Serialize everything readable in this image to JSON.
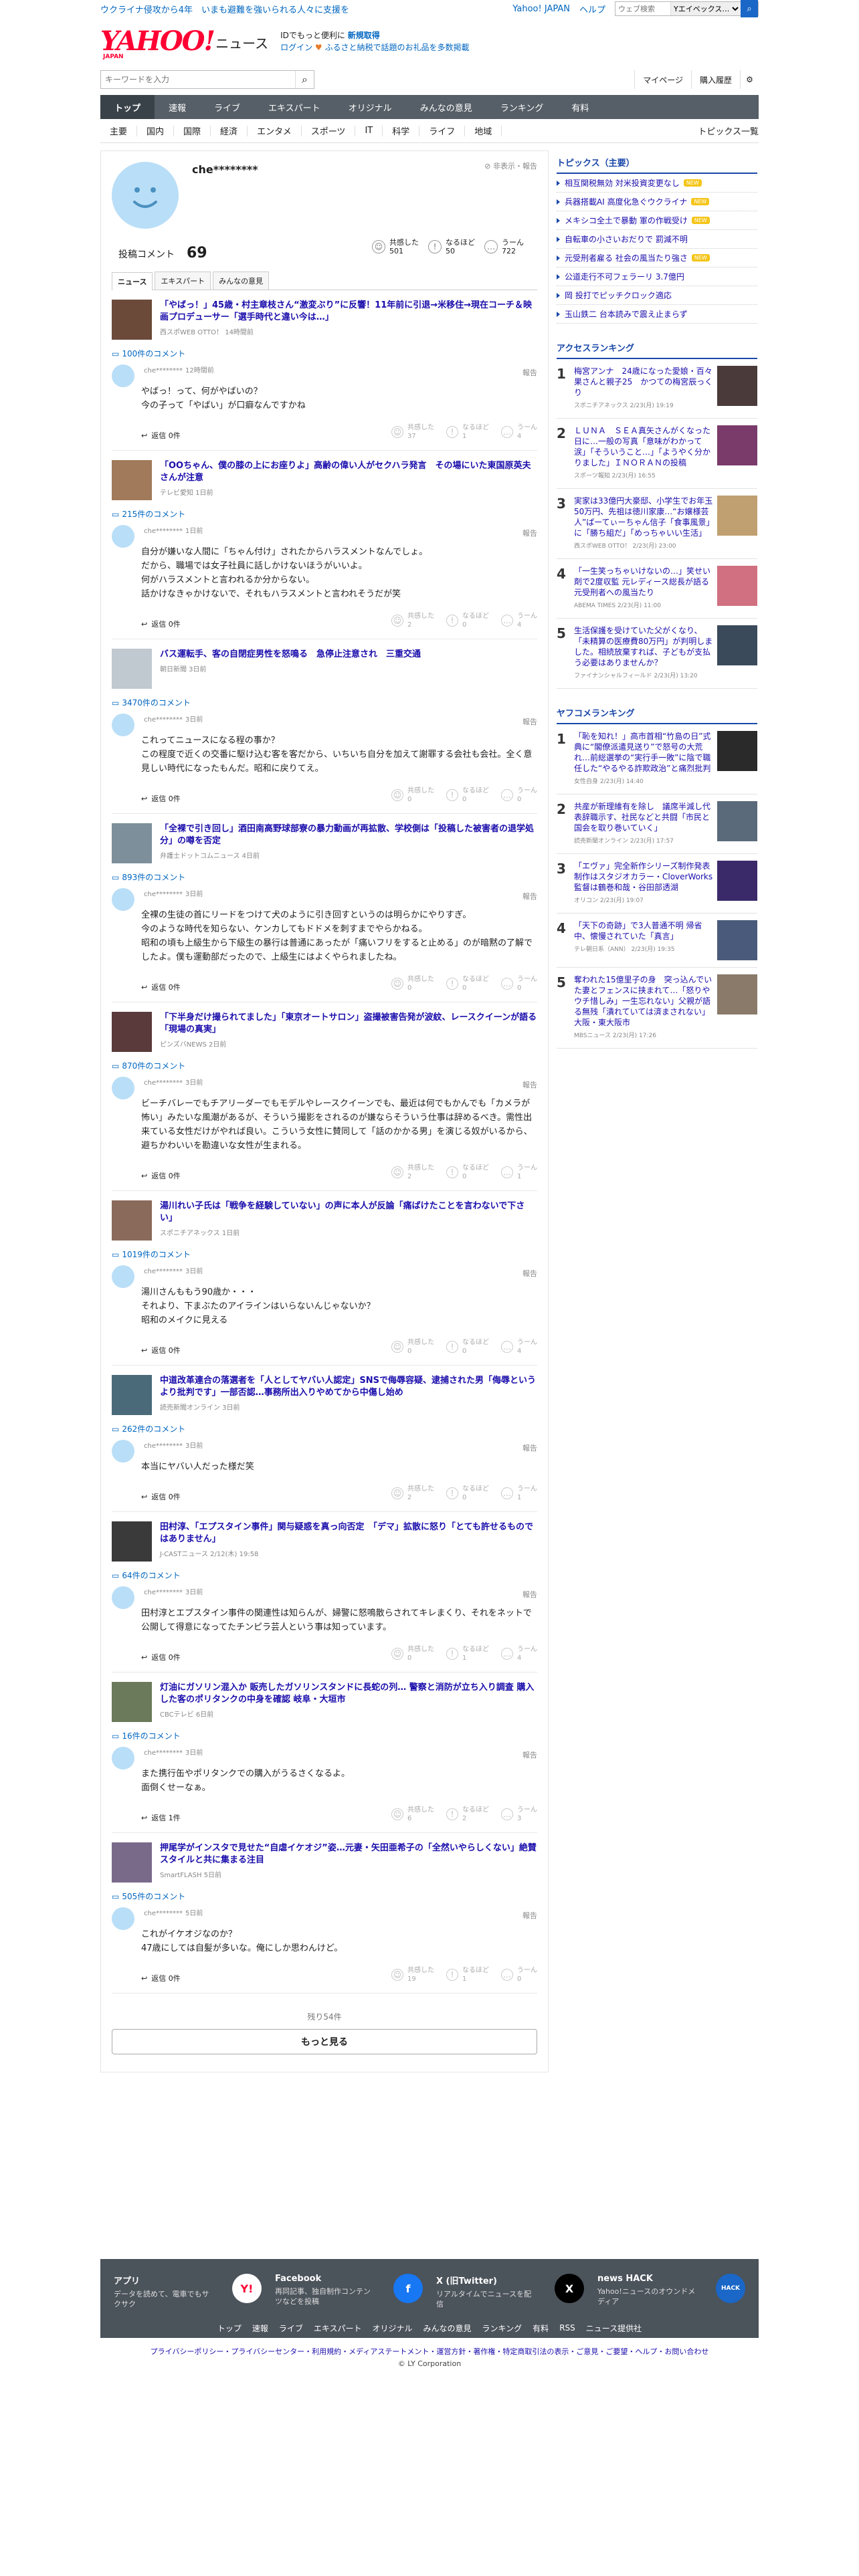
{
  "header": {
    "promo": "ウクライナ侵攻から4年　いまも避難を強いられる人々に支援を",
    "links": [
      "Yahoo! JAPAN",
      "ヘルプ"
    ],
    "mini_search_placeholder": "ウェブ検索",
    "mini_search_scope": "Yエイベックス…",
    "logo_text": "YAHOO!",
    "logo_sub": "JAPAN",
    "logo_news": "ニュース",
    "msg1": "IDでもっと便利に",
    "msg1b": "新規取得",
    "msg2": "ログイン",
    "msg2b": "ふるさと納税で話題のお礼品を多数掲載",
    "search_placeholder": "キーワードを入力",
    "mypage": "マイページ",
    "history": "購入履歴"
  },
  "nav": [
    "トップ",
    "速報",
    "ライブ",
    "エキスパート",
    "オリジナル",
    "みんなの意見",
    "ランキング",
    "有料"
  ],
  "subnav": [
    "主要",
    "国内",
    "国際",
    "経済",
    "エンタメ",
    "スポーツ",
    "IT",
    "科学",
    "ライフ",
    "地域"
  ],
  "subnav_right": "トピックス一覧",
  "profile": {
    "username": "che********",
    "report": "非表示・報告",
    "count_label": "投稿コメント",
    "count": "69",
    "stats": [
      {
        "icon": "☺",
        "label": "共感した",
        "value": "501"
      },
      {
        "icon": "!",
        "label": "なるほど",
        "value": "50"
      },
      {
        "icon": "…",
        "label": "うーん",
        "value": "722"
      }
    ],
    "tabs": [
      "ニュース",
      "エキスパート",
      "みんなの意見"
    ]
  },
  "items": [
    {
      "title": "「やばっ！」45歳・村主章枝さん“激変ぶり”に反響！11年前に引退→米移住→現在コーチ＆映画プロデューサー「選手時代と違い今は…」",
      "src": "西スポWEB OTTO！ 14時間前",
      "ccount": "100件のコメント",
      "user": "che********",
      "time": "12時間前",
      "text": "やばっ！って、何がやばいの？\n今の子って「やばい」が口癖なんですかね",
      "reply": "返信 0件",
      "r": [
        "37",
        "1",
        "4"
      ],
      "thumbColor": "#6b4a3a"
    },
    {
      "title": "「OOちゃん、僕の膝の上にお座りよ」高齢の偉い人がセクハラ発言　その場にいた東国原英夫さんが注意",
      "src": "テレビ愛知 1日前",
      "ccount": "215件のコメント",
      "user": "che********",
      "time": "1日前",
      "text": "自分が嫌いな人間に「ちゃん付け」されたからハラスメントなんでしょ。\nだから、職場では女子社員に話しかけないほうがいいよ。\n何がハラスメントと言われるか分からない。\n話かけなきゃかけないで、それもハラスメントと言われそうだが笑",
      "reply": "返信 0件",
      "r": [
        "2",
        "0",
        "4"
      ],
      "thumbColor": "#a07a5a"
    },
    {
      "title": "バス運転手、客の自閉症男性を怒鳴る　急停止注意され　三重交通",
      "src": "朝日新聞 3日前",
      "ccount": "3470件のコメント",
      "user": "che********",
      "time": "3日前",
      "text": "これってニュースになる程の事か？\nこの程度で近くの交番に駆け込む客を客だから、いちいち自分を加えて謝罪する会社も会社。全く意見しい時代になったもんだ。昭和に戻りてえ。",
      "reply": "返信 0件",
      "r": [
        "0",
        "0",
        "0"
      ],
      "thumbColor": "#c0c8d0"
    },
    {
      "title": "「全裸で引き回し」酒田南高野球部寮の暴力動画が再拡散、学校側は「投稿した被害者の退学処分」の噂を否定",
      "src": "弁護士ドットコムニュース 4日前",
      "ccount": "893件のコメント",
      "user": "che********",
      "time": "3日前",
      "text": "全裸の生徒の首にリードをつけて犬のように引き回すというのは明らかにやりすぎ。\n今のような時代を知らない、ケンカしてもドドメを刺すまでやらかねる。\n昭和の頃も上級生から下級生の暴行は普通にあったが「痛いフリをすると止める」のが暗黙の了解でしたよ。僕も運動部だったので、上級生にはよくやられましたね。",
      "reply": "返信 0件",
      "r": [
        "0",
        "0",
        "0"
      ],
      "thumbColor": "#7d8f9a"
    },
    {
      "title": "「下半身だけ撮られてました」「東京オートサロン」盗撮被害告発が波紋、レースクイーンが語る「現場の真実」",
      "src": "ピンズバNEWS 2日前",
      "ccount": "870件のコメント",
      "user": "che********",
      "time": "3日前",
      "text": "ビーチバレーでもチアリーダーでもモデルやレースクイーンでも、最近は何でもかんでも「カメラが怖い」みたいな風潮があるが、そういう撮影をされるのが嫌ならそういう仕事は辞めるべき。需性出来ている女性だけがやれば良い。こういう女性に賛同して「話のかかる男」を演じる奴がいるから、避ちかわいいを勘違いな女性が生まれる。",
      "reply": "返信 0件",
      "r": [
        "2",
        "0",
        "1"
      ],
      "thumbColor": "#5a3a3a"
    },
    {
      "title": "湯川れい子氏は「戦争を経験していない」の声に本人が反論「痛ばけたことを言わないで下さい」",
      "src": "スポニチアネックス 1日前",
      "ccount": "1019件のコメント",
      "user": "che********",
      "time": "3日前",
      "text": "湯川さんももう90歳か・・・\nそれより、下まぶたのアイラインはいらないんじゃないか？\n昭和のメイクに見える",
      "reply": "返信 0件",
      "r": [
        "0",
        "0",
        "4"
      ],
      "thumbColor": "#8a6a5a"
    },
    {
      "title": "中道改革連合の落選者を「人としてヤバい人認定」SNSで侮辱容疑、逮捕された男「侮辱というより批判です」一部否認…事務所出入りやめてから中傷し始め",
      "src": "読売新聞オンライン 3日前",
      "ccount": "262件のコメント",
      "user": "che********",
      "time": "3日前",
      "text": "本当にヤバい人だった様だ笑",
      "reply": "返信 0件",
      "r": [
        "2",
        "0",
        "1"
      ],
      "thumbColor": "#4a6a7a"
    },
    {
      "title": "田村淳、「エプスタイン事件」関与疑惑を真っ向否定　「デマ」拡散に怒り「とても許せるものではありません」",
      "src": "J-CASTニュース 2/12(木) 19:58",
      "ccount": "64件のコメント",
      "user": "che********",
      "time": "3日前",
      "text": "田村淳とエプスタイン事件の関連性は知らんが、婦警に怒鳴散らされてキレまくり、それをネットで公開して得意になってたチンピラ芸人という事は知っています。",
      "reply": "返信 0件",
      "r": [
        "0",
        "1",
        "4"
      ],
      "thumbColor": "#3a3a3a"
    },
    {
      "title": "灯油にガソリン混入か 販売したガソリンスタンドに長蛇の列… 警察と消防が立ち入り調査 購入した客のポリタンクの中身を確認 岐阜・大垣市",
      "src": "CBCテレビ 6日前",
      "ccount": "16件のコメント",
      "user": "che********",
      "time": "3日前",
      "text": "また携行缶やポリタンクでの購入がうるさくなるよ。\n面倒くせーなぁ。",
      "reply": "返信 1件",
      "r": [
        "6",
        "2",
        "3"
      ],
      "thumbColor": "#6a7a5a"
    },
    {
      "title": "押尾学がインスタで見せた“自虐イケオジ”姿…元妻・矢田亜希子の「全然いやらしくない」絶賛スタイルと共に集まる注目",
      "src": "SmartFLASH 5日前",
      "ccount": "505件のコメント",
      "user": "che********",
      "time": "5日前",
      "text": "これがイケオジなのか？\n47歳にしては自髪が多いな。俺にしか思わんけど。",
      "reply": "返信 0件",
      "r": [
        "19",
        "1",
        "0"
      ],
      "thumbColor": "#7a6a8a"
    }
  ],
  "more": {
    "remaining": "残り54件",
    "button": "もっと見る"
  },
  "sidebar": {
    "topics_title": "トピックス（主要）",
    "topics": [
      {
        "t": "相互関税無効 対米投資変更なし",
        "new": "NEW"
      },
      {
        "t": "兵器搭載AI 高度化急ぐウクライナ",
        "new": "NEW"
      },
      {
        "t": "メキシコ全土で暴動 軍の作戦受け",
        "new": "NEW"
      },
      {
        "t": "自転車の小さいおだりで 罰減不明",
        "new": ""
      },
      {
        "t": "元受刑者雇る 社会の風当たり強さ",
        "new": "NEW"
      },
      {
        "t": "公道走行不可フェラーリ 3.7億円",
        "new": ""
      },
      {
        "t": "岡 投打でピッチクロック適応",
        "new": ""
      },
      {
        "t": "玉山鉄二 台本読みで震え止まらず",
        "new": ""
      }
    ],
    "access_title": "アクセスランキング",
    "access": [
      {
        "n": "1",
        "t": "梅宮アンナ　24歳になった愛娘・百々果さんと親子25　かつての梅宮辰っくり",
        "m": "スポニチアネックス 2/23(月) 19:19",
        "c": "#4a3a3a"
      },
      {
        "n": "2",
        "t": "ＬＵＮＡ　ＳＥＡ真矢さんがくなった日に…一般の写真「意味がわかって涙」「そういうこと…」「ようやく分かりました」ＩＮＯＲＡＮの投稿",
        "m": "スポーツ報知 2/23(月) 16:55",
        "c": "#7a3a6a"
      },
      {
        "n": "3",
        "t": "実家は33億円大豪邸、小学生でお年玉50万円、先祖は徳川家康…“お嬢様芸人”ぱーてぃーちゃん信子「食事風景」に「勝ち組だ」「めっちゃいい生活」",
        "m": "西スポWEB OTTO！ 2/23(月) 23:00",
        "c": "#c0a070"
      },
      {
        "n": "4",
        "t": "「一生笑っちゃいけないの…」笑せい剤で2度収監 元レディース総長が語る元受刑者への風当たり",
        "m": "ABEMA TIMES 2/23(月) 11:00",
        "c": "#d07080"
      },
      {
        "n": "5",
        "t": "生活保護を受けていた父がくなり、「未精算の医療費80万円」が判明しました。相続放棄すれば、子どもが支払う必要はありませんか？",
        "m": "ファイナンシャルフィールド 2/23(月) 13:20",
        "c": "#3a4a5a"
      }
    ],
    "yafoko_title": "ヤフコメランキング",
    "yafoko": [
      {
        "n": "1",
        "t": "「恥を知れ！」高市首相“竹島の日”式典に“閣僚派遣見送り”で怒号の大荒れ…前総選挙の“実行手一敗”に陰で職任した“やるやる詐欺政治”と痛烈批判",
        "m": "女性自身 2/23(月) 14:40",
        "c": "#2a2a2a"
      },
      {
        "n": "2",
        "t": "共産が新理維有を除し　議席半減し代表辞職示す、社民などと共闘「市民と国会を取り巻いていく」",
        "m": "読売新聞オンライン 2/23(月) 17:57",
        "c": "#5a6a7a"
      },
      {
        "n": "3",
        "t": "「エヴァ」完全新作シリーズ制作発表　制作はスタジオカラー・CloverWorks　監督は鶴巻和哉・谷田部透湖",
        "m": "オリコン 2/23(月) 19:07",
        "c": "#3a2a6a"
      },
      {
        "n": "4",
        "t": "「天下の奇跡」で3人普通不明 帰省中、懐慢されていた「真言」",
        "m": "テレ朝日系（ANN） 2/23(月) 19:35",
        "c": "#4a5a7a"
      },
      {
        "n": "5",
        "t": "奪われた15億里子の身　突っ込んでいた妻とフェンスに挟まれて…「怒りやウチ惜しみ」一生忘れない」父親が語る無残「潰れていては済まされない」　大阪・東大阪市",
        "m": "MBSニュース 2/23(月) 17:26",
        "c": "#8a7a6a"
      }
    ]
  },
  "footer": {
    "apps": [
      {
        "h": "アプリ",
        "d": "データを読めて、電車でもサクサク",
        "icon": "Y!",
        "color": "#ffffff",
        "fg": "#ff0033"
      },
      {
        "h": "Facebook",
        "d": "再同記事、独自制作コンテンツなどを投稿",
        "icon": "f",
        "color": "#1877f2",
        "fg": "#ffffff"
      },
      {
        "h": "X (旧Twitter)",
        "d": "リアルタイムでニュースを配信",
        "icon": "X",
        "color": "#000000",
        "fg": "#ffffff"
      },
      {
        "h": "news HACK",
        "d": "Yahoo!ニュースのオウンドメディア",
        "icon": "HACK",
        "color": "#1a67c7",
        "fg": "#ffffff"
      }
    ],
    "nav": [
      "トップ",
      "速報",
      "ライブ",
      "エキスパート",
      "オリジナル",
      "みんなの意見",
      "ランキング",
      "有料",
      "RSS",
      "ニュース提供社"
    ],
    "legal": "プライバシーポリシー・プライバシーセンター・利用規約・メディアステートメント・運営方針・著作権・特定商取引法の表示・ご意見・ご要望・ヘルプ・お問い合わせ",
    "copy": "© LY Corporation"
  }
}
